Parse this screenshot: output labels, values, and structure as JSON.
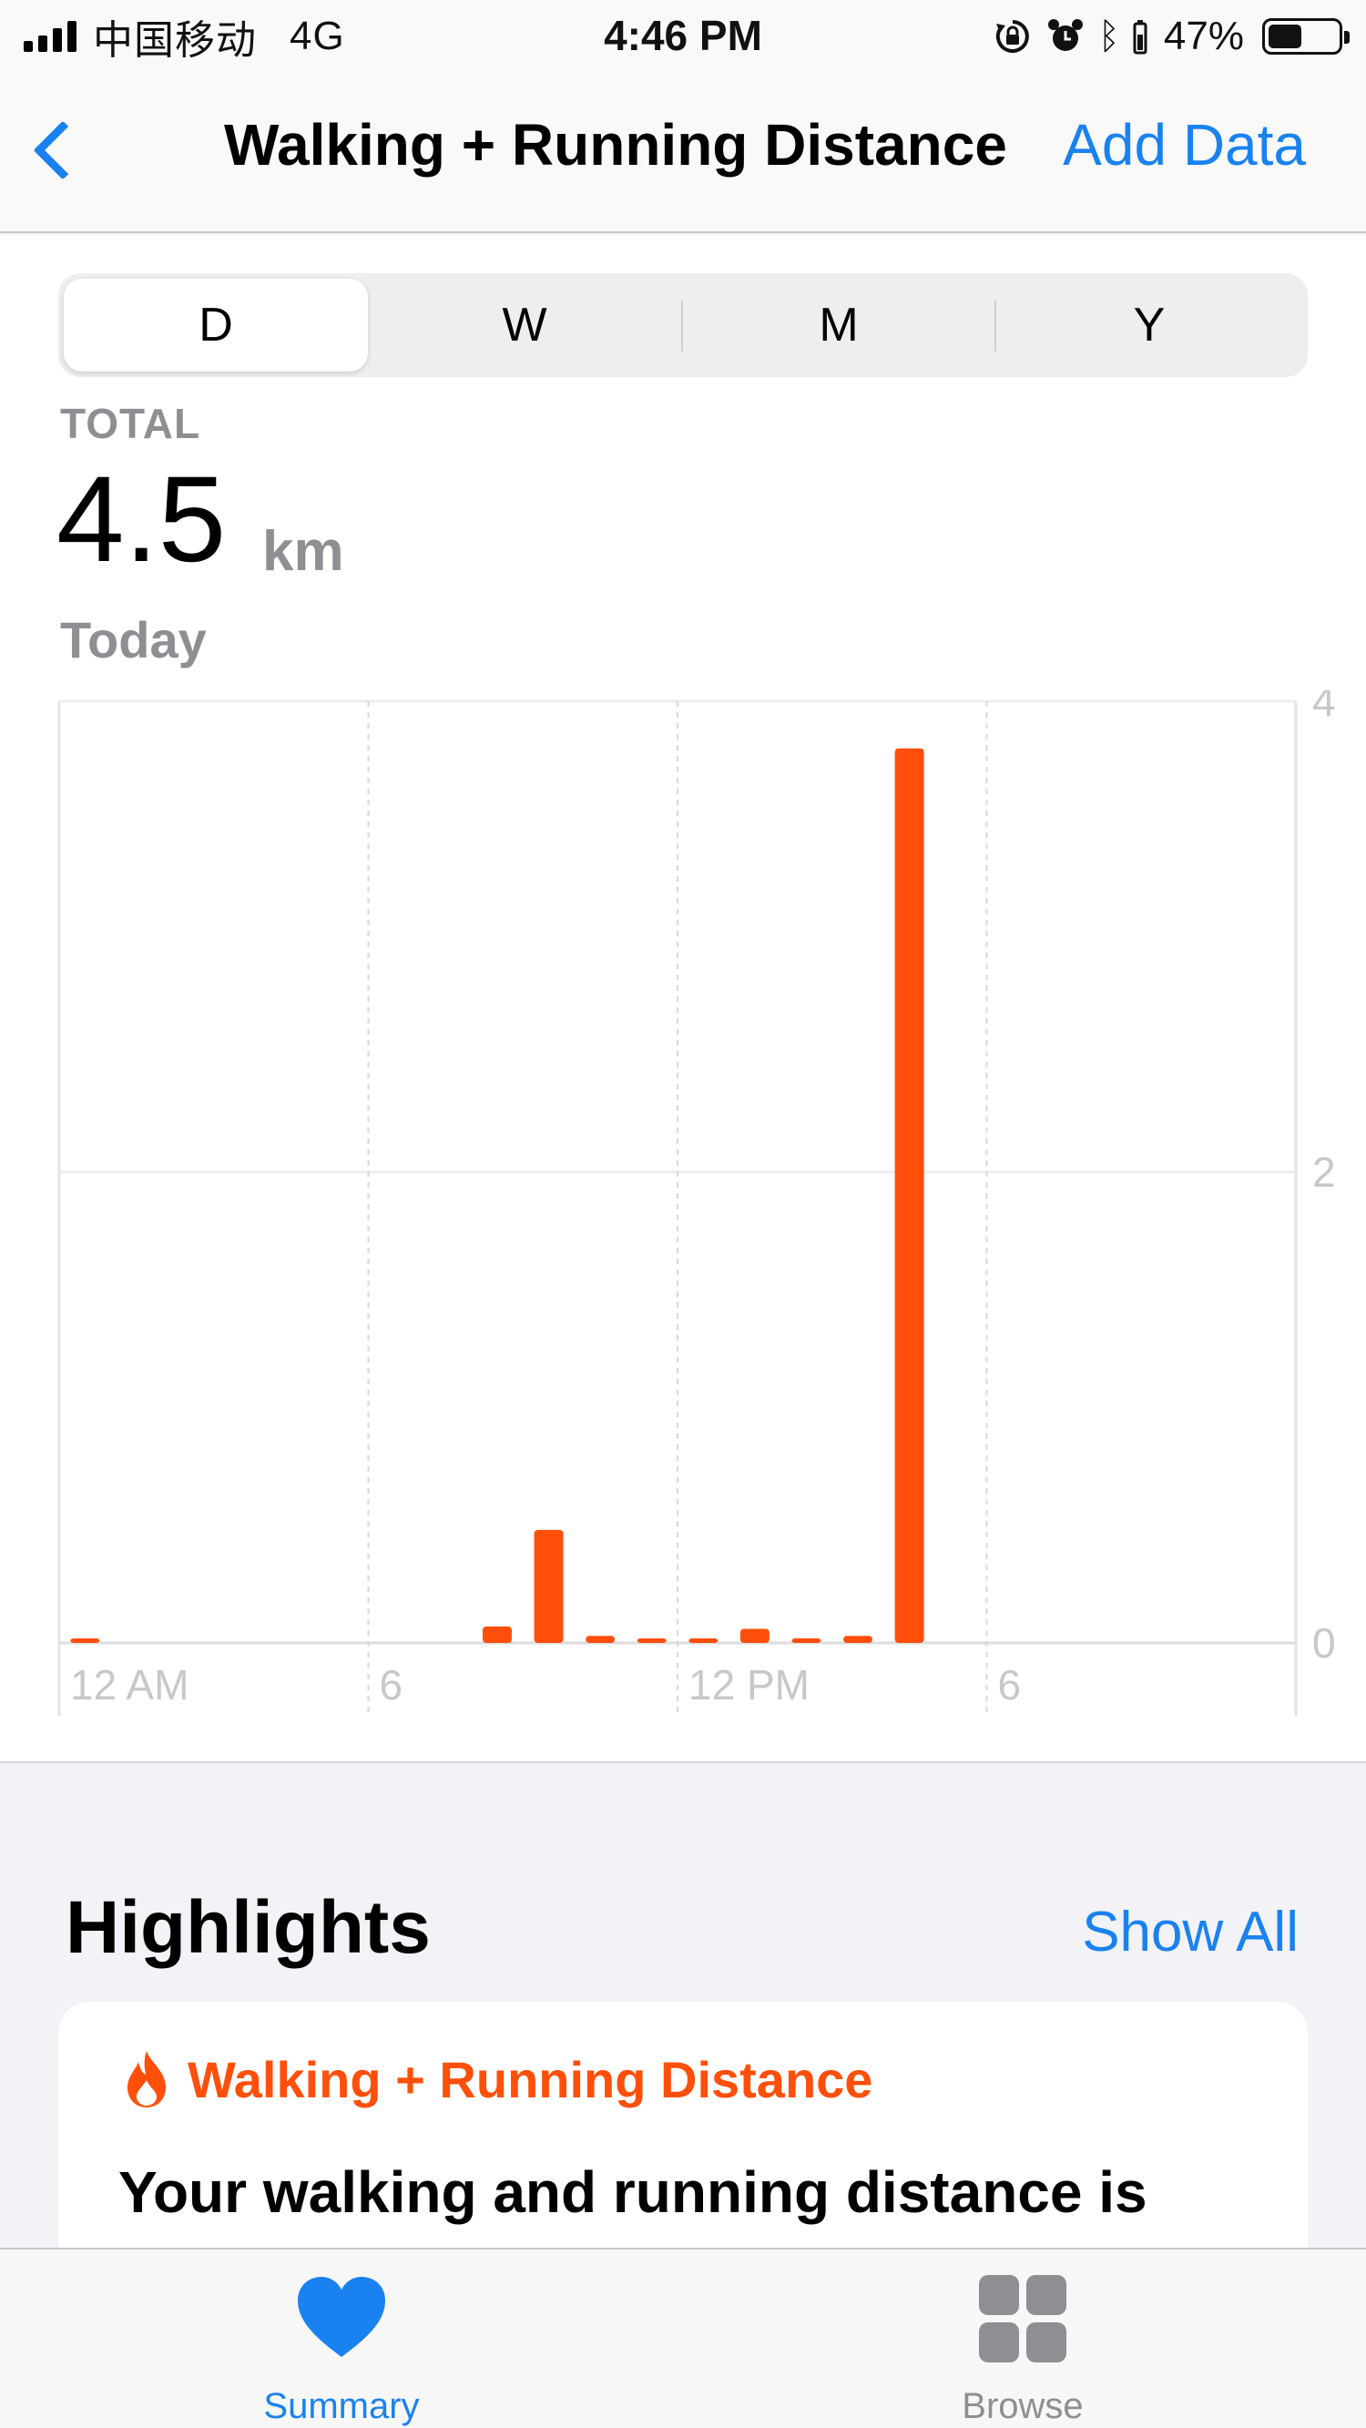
{
  "status_bar": {
    "carrier": "中国移动",
    "network": "4G",
    "time": "4:46 PM",
    "battery_percent": "47%",
    "battery_level": 0.47,
    "icons": [
      "signal-icon",
      "orientation-lock-icon",
      "alarm-icon",
      "bluetooth-icon",
      "battery-icon"
    ]
  },
  "nav": {
    "back_icon": "chevron-left-icon",
    "title": "Walking + Running Distance",
    "action": "Add Data"
  },
  "segmented_control": {
    "options": [
      "D",
      "W",
      "M",
      "Y"
    ],
    "selected": "D"
  },
  "summary": {
    "label": "TOTAL",
    "value": "4.5",
    "unit": "km",
    "date": "Today"
  },
  "chart_data": {
    "type": "bar",
    "title": "",
    "xlabel": "",
    "ylabel": "",
    "x_tick_labels": [
      "12 AM",
      "6",
      "12 PM",
      "6"
    ],
    "y_tick_labels": [
      "0",
      "2",
      "4"
    ],
    "ylim": [
      0,
      4
    ],
    "x_range_hours": [
      0,
      24
    ],
    "bar_color": "#ff4f0a",
    "grid": true,
    "series": [
      {
        "hours": [
          0,
          8,
          9,
          10,
          11,
          12,
          13,
          14,
          15,
          16
        ],
        "values": [
          0.01,
          0.07,
          0.48,
          0.03,
          0.01,
          0.01,
          0.06,
          0.02,
          0.03,
          3.8
        ]
      }
    ]
  },
  "highlights": {
    "title": "Highlights",
    "show_all": "Show All",
    "card": {
      "icon": "flame-icon",
      "heading": "Walking + Running Distance",
      "body": "Your walking and running distance is"
    }
  },
  "tab_bar": {
    "tabs": [
      {
        "label": "Summary",
        "icon": "heart-icon",
        "active": true
      },
      {
        "label": "Browse",
        "icon": "grid-icon",
        "active": false
      }
    ],
    "active_color": "#1a82f0",
    "inactive_color": "#8e8e93"
  }
}
